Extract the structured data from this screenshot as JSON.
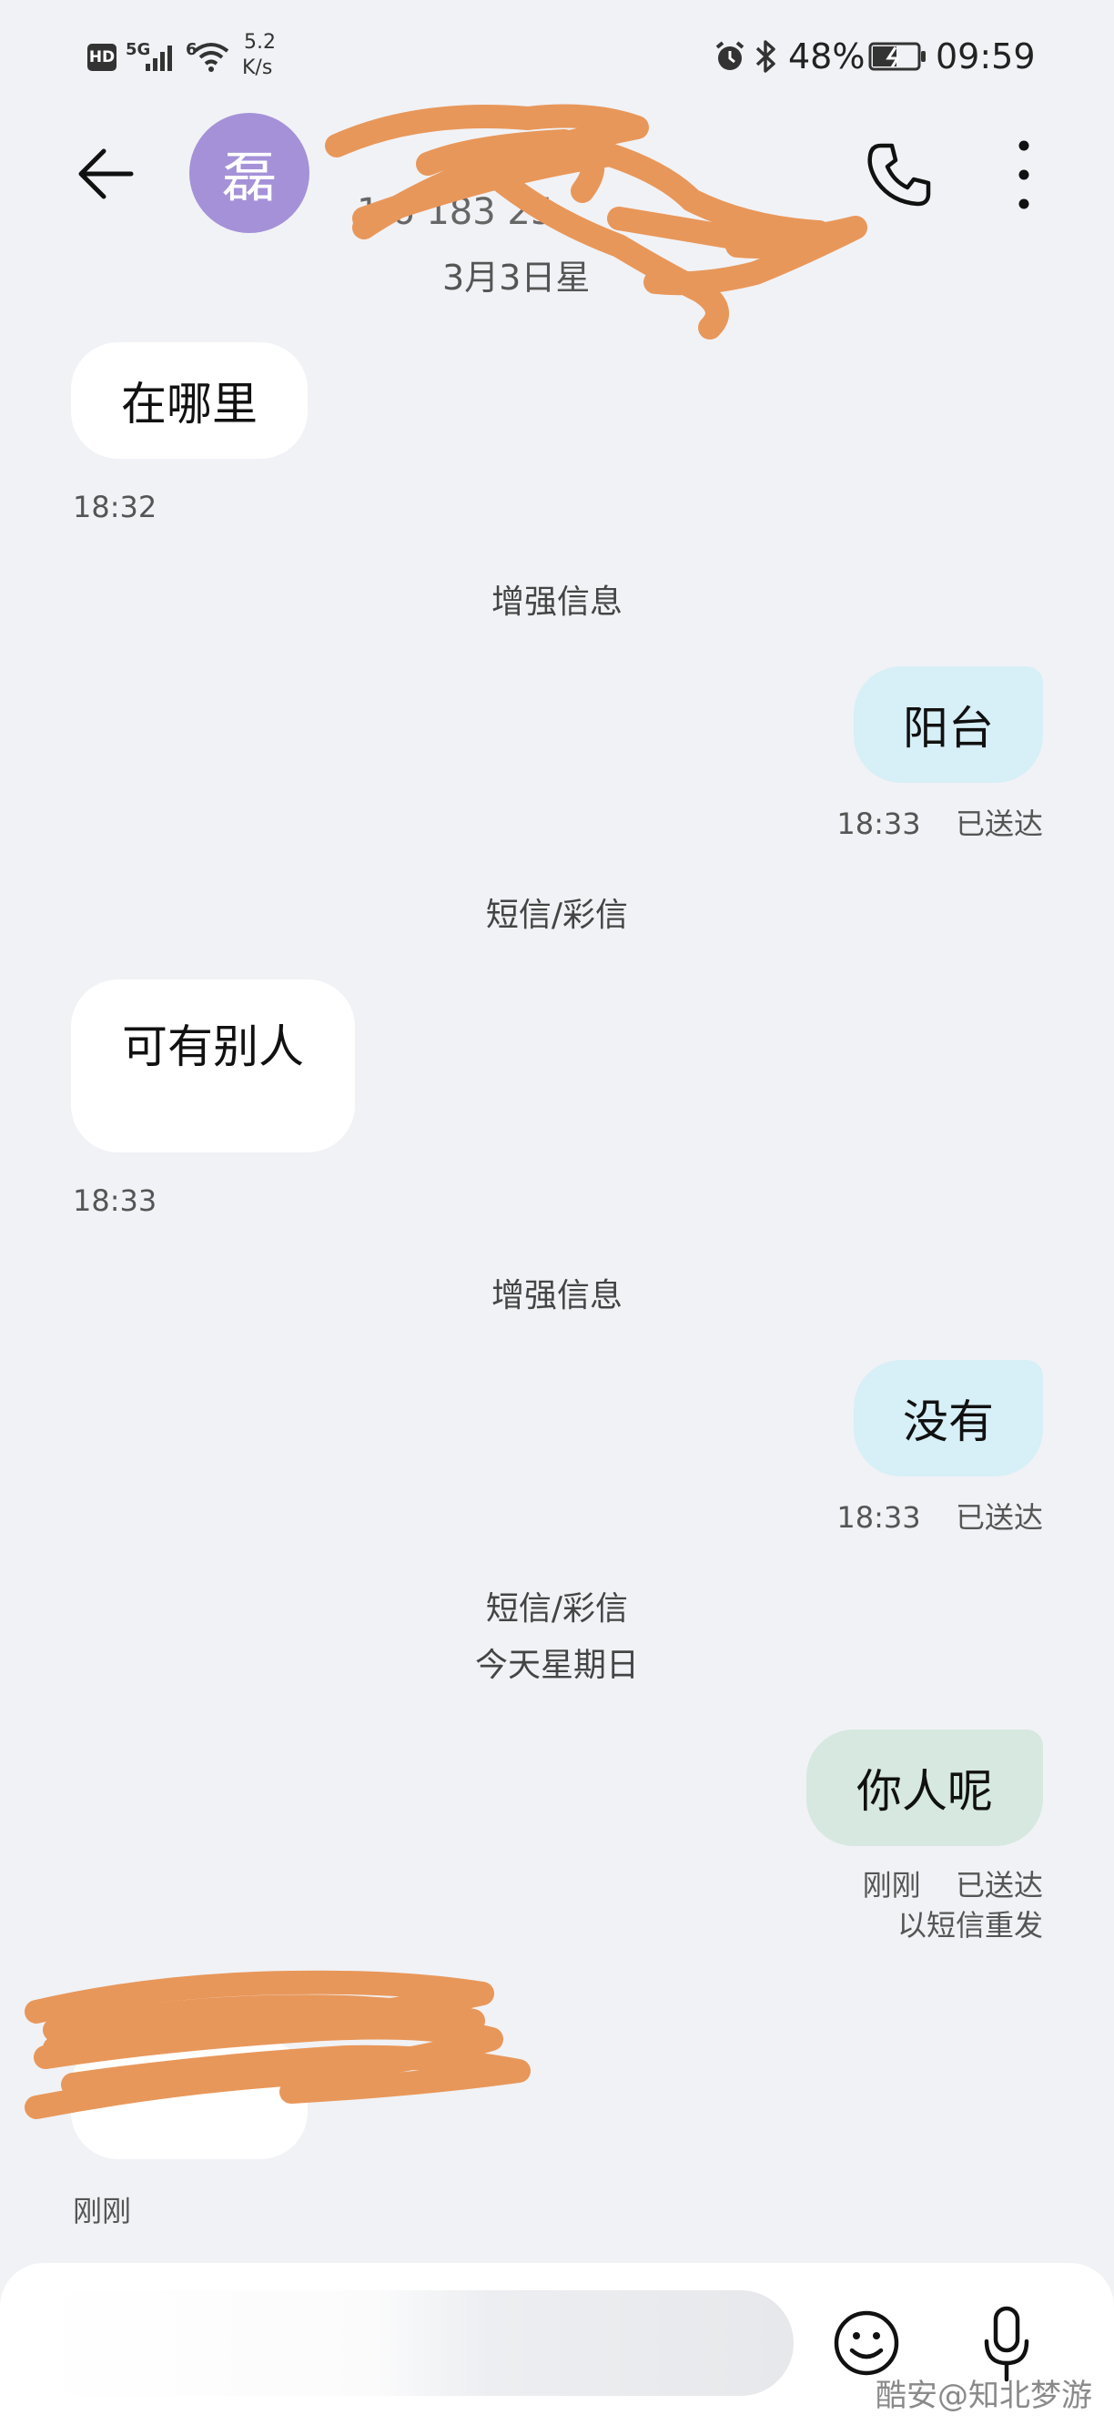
{
  "status_bar": {
    "network_badges": [
      "HD",
      "5G",
      "6"
    ],
    "speed_value": "5.2",
    "speed_unit": "K/s",
    "battery": "48%",
    "time": "09:59",
    "icons": [
      "alarm-icon",
      "bluetooth-icon",
      "battery-charging-icon",
      "wifi-icon",
      "signal-icon"
    ]
  },
  "header": {
    "avatar_char": "磊",
    "number_partial": "1 6 183 25",
    "date_partial": "3月3日星",
    "back_icon": "back-arrow-icon",
    "call_icon": "phone-icon",
    "more_icon": "more-vertical-icon"
  },
  "messages": [
    {
      "dir": "in",
      "text": "在哪里",
      "time": "18:32"
    },
    {
      "label": "增强信息"
    },
    {
      "dir": "out",
      "text": "阳台",
      "time": "18:33",
      "status": "已送达"
    },
    {
      "label": "短信/彩信"
    },
    {
      "dir": "in",
      "text": "可有别人",
      "time": "18:33"
    },
    {
      "label": "增强信息"
    },
    {
      "dir": "out",
      "text": "没有",
      "time": "18:33",
      "status": "已送达"
    },
    {
      "label": "短信/彩信"
    },
    {
      "label": "今天星期日"
    },
    {
      "dir": "out",
      "text": "你人呢",
      "time": "刚刚",
      "status": "已送达",
      "note": "以短信重发"
    },
    {
      "dir": "in",
      "text": "",
      "time": "刚刚"
    }
  ],
  "input": {
    "emoji_icon": "emoji-icon",
    "mic_icon": "microphone-icon"
  },
  "watermark": "酷安@知北梦游",
  "colors": {
    "background": "#f1f2f6",
    "bubble_in": "#ffffff",
    "bubble_out": "#d7eff6",
    "bubble_out_resent": "#d6e8e0",
    "avatar": "#a591d8",
    "scribble": "#e8975a"
  }
}
